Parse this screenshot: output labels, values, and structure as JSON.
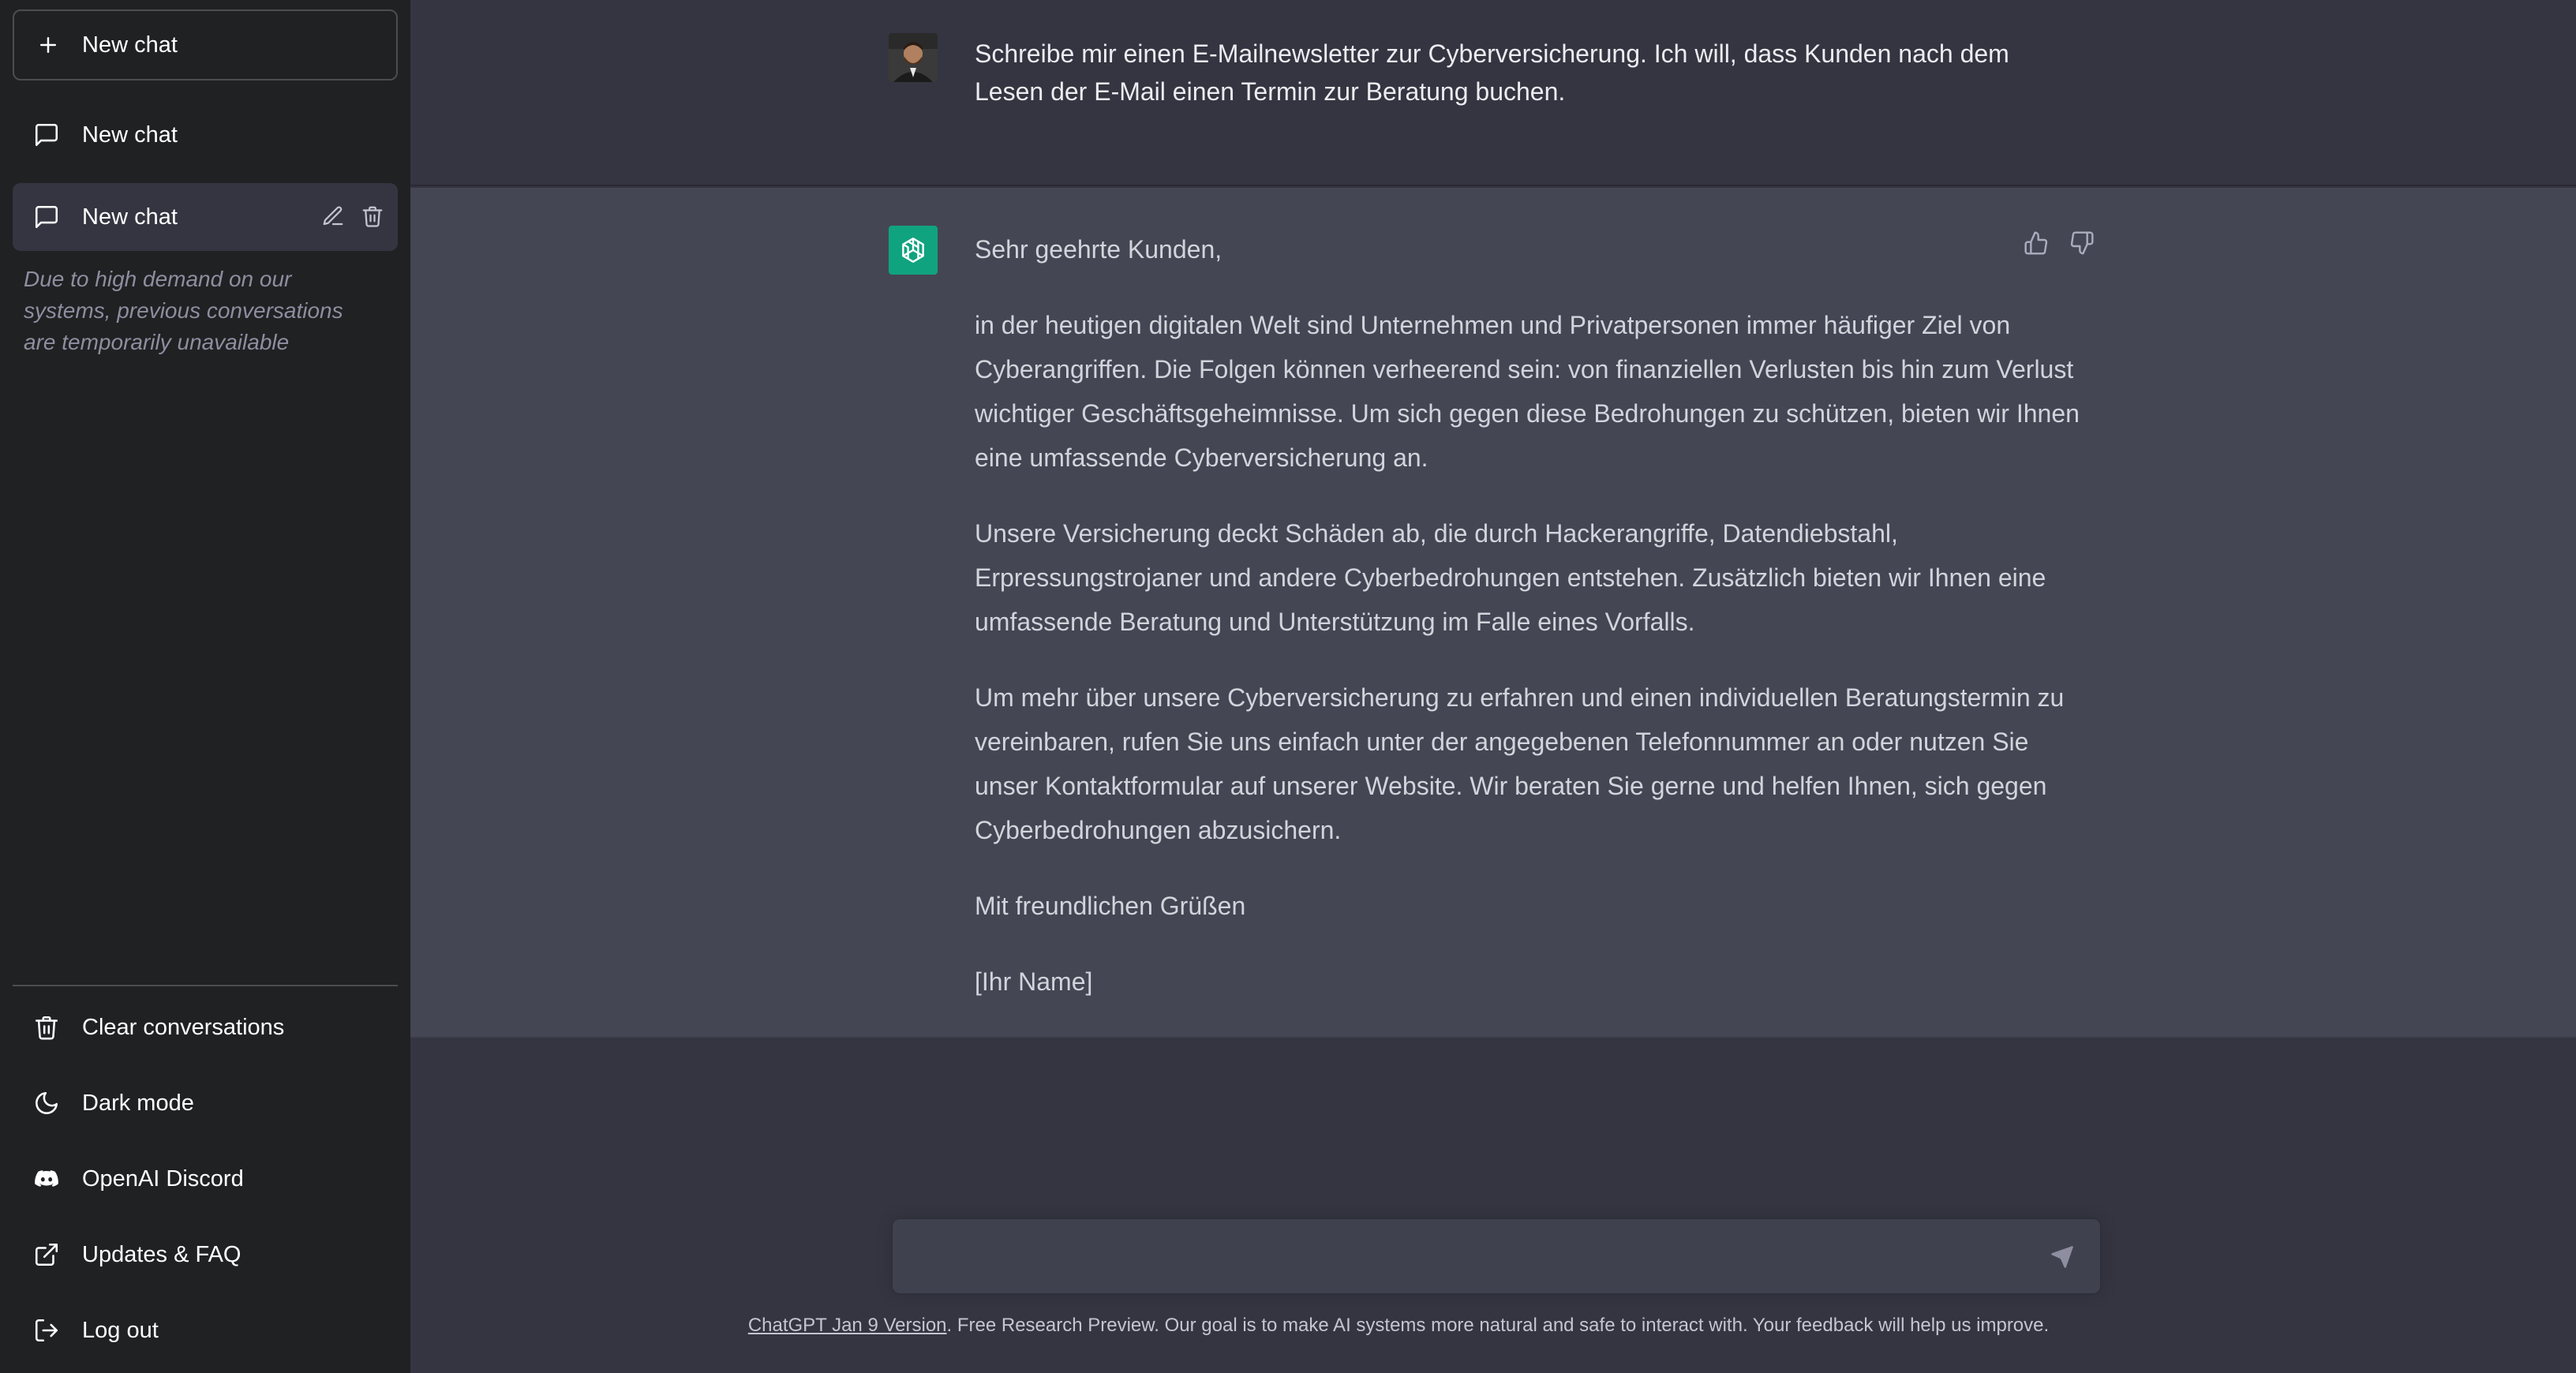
{
  "sidebar": {
    "new_chat_button": "New chat",
    "chats": [
      {
        "label": "New chat"
      },
      {
        "label": "New chat"
      }
    ],
    "notice": "Due to high demand on our systems, previous conversations are temporarily unavailable",
    "menu": [
      {
        "label": "Clear conversations",
        "icon": "trash-icon"
      },
      {
        "label": "Dark mode",
        "icon": "moon-icon"
      },
      {
        "label": "OpenAI Discord",
        "icon": "discord-icon"
      },
      {
        "label": "Updates & FAQ",
        "icon": "external-link-icon"
      },
      {
        "label": "Log out",
        "icon": "logout-icon"
      }
    ]
  },
  "conversation": {
    "user_message": "Schreibe mir einen E-Mailnewsletter zur Cyberversicherung. Ich will, dass Kunden nach dem Lesen der E-Mail einen Termin zur Beratung buchen.",
    "assistant_paragraphs": [
      "Sehr geehrte Kunden,",
      "in der heutigen digitalen Welt sind Unternehmen und Privatpersonen immer häufiger Ziel von Cyberangriffen. Die Folgen können verheerend sein: von finanziellen Verlusten bis hin zum Verlust wichtiger Geschäftsgeheimnisse. Um sich gegen diese Bedrohungen zu schützen, bieten wir Ihnen eine umfassende Cyberversicherung an.",
      "Unsere Versicherung deckt Schäden ab, die durch Hackerangriffe, Datendiebstahl, Erpressungstrojaner und andere Cyberbedrohungen entstehen. Zusätzlich bieten wir Ihnen eine umfassende Beratung und Unterstützung im Falle eines Vorfalls.",
      "Um mehr über unsere Cyberversicherung zu erfahren und einen individuellen Beratungstermin zu vereinbaren, rufen Sie uns einfach unter der angegebenen Telefonnummer an oder nutzen Sie unser Kontaktformular auf unserer Website. Wir beraten Sie gerne und helfen Ihnen, sich gegen Cyberbedrohungen abzusichern.",
      "Mit freundlichen Grüßen",
      "[Ihr Name]"
    ]
  },
  "input": {
    "placeholder": ""
  },
  "footer": {
    "link_text": "ChatGPT Jan 9 Version",
    "text": ". Free Research Preview. Our goal is to make AI systems more natural and safe to interact with. Your feedback will help us improve."
  },
  "colors": {
    "sidebar_bg": "#202123",
    "main_bg": "#343541",
    "assistant_bg": "#444654",
    "input_bg": "#40414f",
    "brand_green": "#10a37f"
  }
}
